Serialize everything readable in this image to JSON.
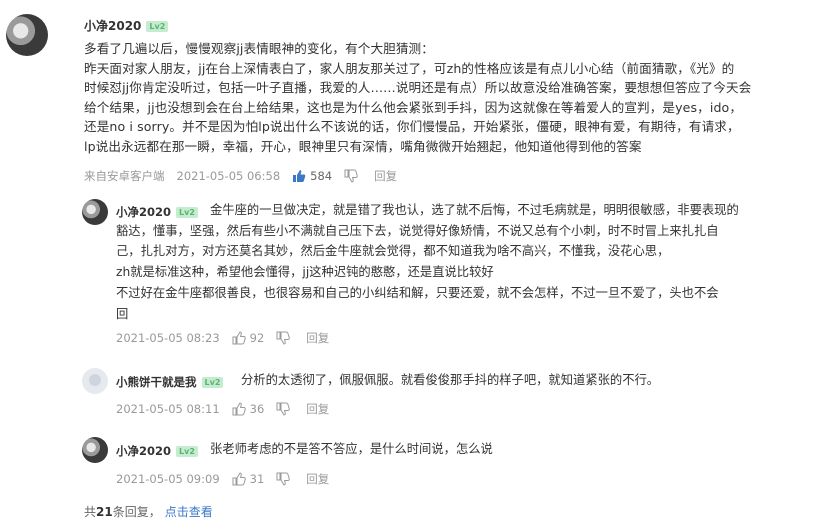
{
  "main_comment": {
    "username": "小净2020",
    "level": "Lv2",
    "text_lines": [
      "多看了几遍以后，慢慢观察jj表情眼神的变化，有个大胆猜测：",
      "昨天面对家人朋友，jj在台上深情表白了，家人朋友那关过了，可zh的性格应该是有点儿小心结（前面猜歌，《光》的",
      "时候怼jj你肯定没听过，包括一叶子直播，我爱的人……说明还是有点）所以故意没给准确答案，要想想但答应了今天会",
      "给个结果，jj也没想到会在台上给结果，这也是为什么他会紧张到手抖，因为这就像在等着爱人的宣判，是yes，ido，",
      "还是no i sorry。并不是因为怕lp说出什么不该说的话，你们慢慢品，开始紧张，僵硬，眼神有爱，有期待，有请求，",
      "lp说出永远都在那一瞬，幸福，开心，眼神里只有深情，嘴角微微开始翘起，他知道他得到他的答案"
    ],
    "source": "来自安卓客户端",
    "time": "2021-05-05 06:58",
    "likes": "584",
    "reply_label": "回复"
  },
  "replies": [
    {
      "username": "小净2020",
      "level": "Lv2",
      "text_lines": [
        "金牛座的一旦做决定，就是错了我也认，选了就不后悔，不过毛病就是，明明很敏感，非要表现的",
        "豁达，懂事，坚强，然后有些小不满就自己压下去，说觉得好像矫情，不说又总有个小刺，时不时冒上来扎扎自",
        "己，扎扎对方，对方还莫名其妙，然后金牛座就会觉得，都不知道我为啥不高兴，不懂我，没花心思，",
        "zh就是标准这种，希望他会懂得，jj这种迟钝的憨憨，还是直说比较好",
        "不过好在金牛座都很善良，也很容易和自己的小纠结和解，只要还爱，就不会怎样，不过一旦不爱了，头也不会",
        "回"
      ],
      "time": "2021-05-05 08:23",
      "likes": "92",
      "reply_label": "回复"
    },
    {
      "username": "小熊饼干就是我",
      "level": "Lv2",
      "text_lines": [
        "分析的太透彻了，佩服佩服。就看俊俊那手抖的样子吧，就知道紧张的不行。"
      ],
      "time": "2021-05-05 08:11",
      "likes": "36",
      "reply_label": "回复"
    },
    {
      "username": "小净2020",
      "level": "Lv2",
      "text_lines": [
        "张老师考虑的不是答不答应，是什么时间说，怎么说"
      ],
      "time": "2021-05-05 09:09",
      "likes": "31",
      "reply_label": "回复"
    }
  ],
  "footer": {
    "prefix": "共",
    "count": "21",
    "suffix": "条回复，",
    "link": "点击查看"
  },
  "colors": {
    "like_active": "#3c78c8",
    "meta_gray": "#999999",
    "level_badge_bg": "#c5ecd0",
    "level_badge_fg": "#5ab46e",
    "link_blue": "#3c78c8"
  },
  "icons": [
    "thumbs-up-icon",
    "thumbs-down-icon",
    "avatar"
  ]
}
